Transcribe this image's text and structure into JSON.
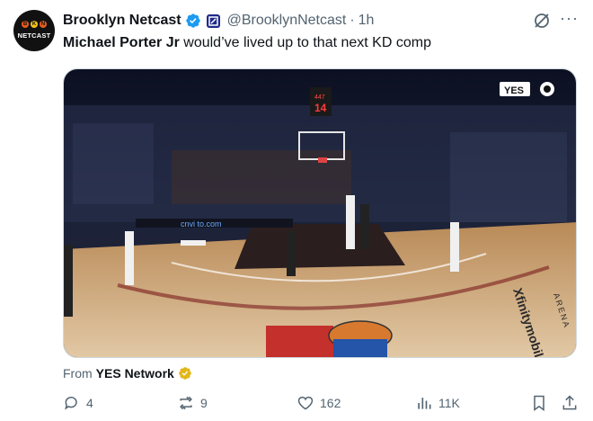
{
  "author": {
    "name": "Brooklyn Netcast",
    "handle": "@BrooklynNetcast",
    "separator": "·",
    "time": "1h",
    "avatar_text": "NETCAST",
    "avatar_dots": [
      "B",
      "K",
      "N"
    ]
  },
  "tweet": {
    "text_bold": "Michael Porter Jr",
    "text_rest": " would’ve lived up to that next KD comp"
  },
  "media": {
    "network_logo": "YES",
    "shot_clock": "14",
    "shot_clock_top": "447",
    "baseline_ad": "cnvi to.com",
    "floor_text": "Xfinitymobile",
    "arena_text": "ARENA"
  },
  "source": {
    "prefix": "From",
    "name": "YES Network"
  },
  "actions": {
    "replies": "4",
    "reposts": "9",
    "likes": "162",
    "views": "11K"
  },
  "colors": {
    "verified_blue": "#1d9bf0",
    "gold_badge": "#e2b719",
    "text_secondary": "#536471",
    "affiliate": "#1f2a8a"
  },
  "icons": [
    "verified-badge-icon",
    "affiliate-badge-icon",
    "grok-icon",
    "more-icon",
    "reply-icon",
    "repost-icon",
    "like-icon",
    "views-icon",
    "bookmark-icon",
    "share-icon"
  ]
}
